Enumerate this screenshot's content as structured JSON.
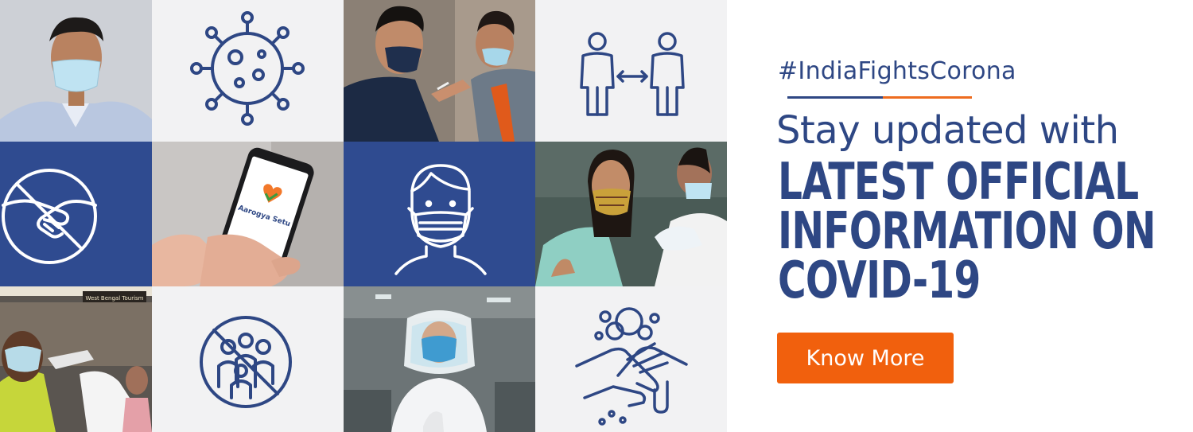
{
  "banner": {
    "hashtag": "#IndiaFightsCorona",
    "subheading": "Stay updated with",
    "headline": [
      "LATEST OFFICIAL",
      "INFORMATION ON",
      "COVID-19"
    ],
    "cta_label": "Know More"
  },
  "tiles": {
    "aarogya_logo_text": "Aarogya Setu",
    "station_sign_text": "West Bengal Tourism"
  },
  "colors": {
    "brand_blue": "#2e4784",
    "tile_blue": "#2f4b90",
    "accent_orange": "#f1600d",
    "tile_light": "#f2f2f3"
  }
}
